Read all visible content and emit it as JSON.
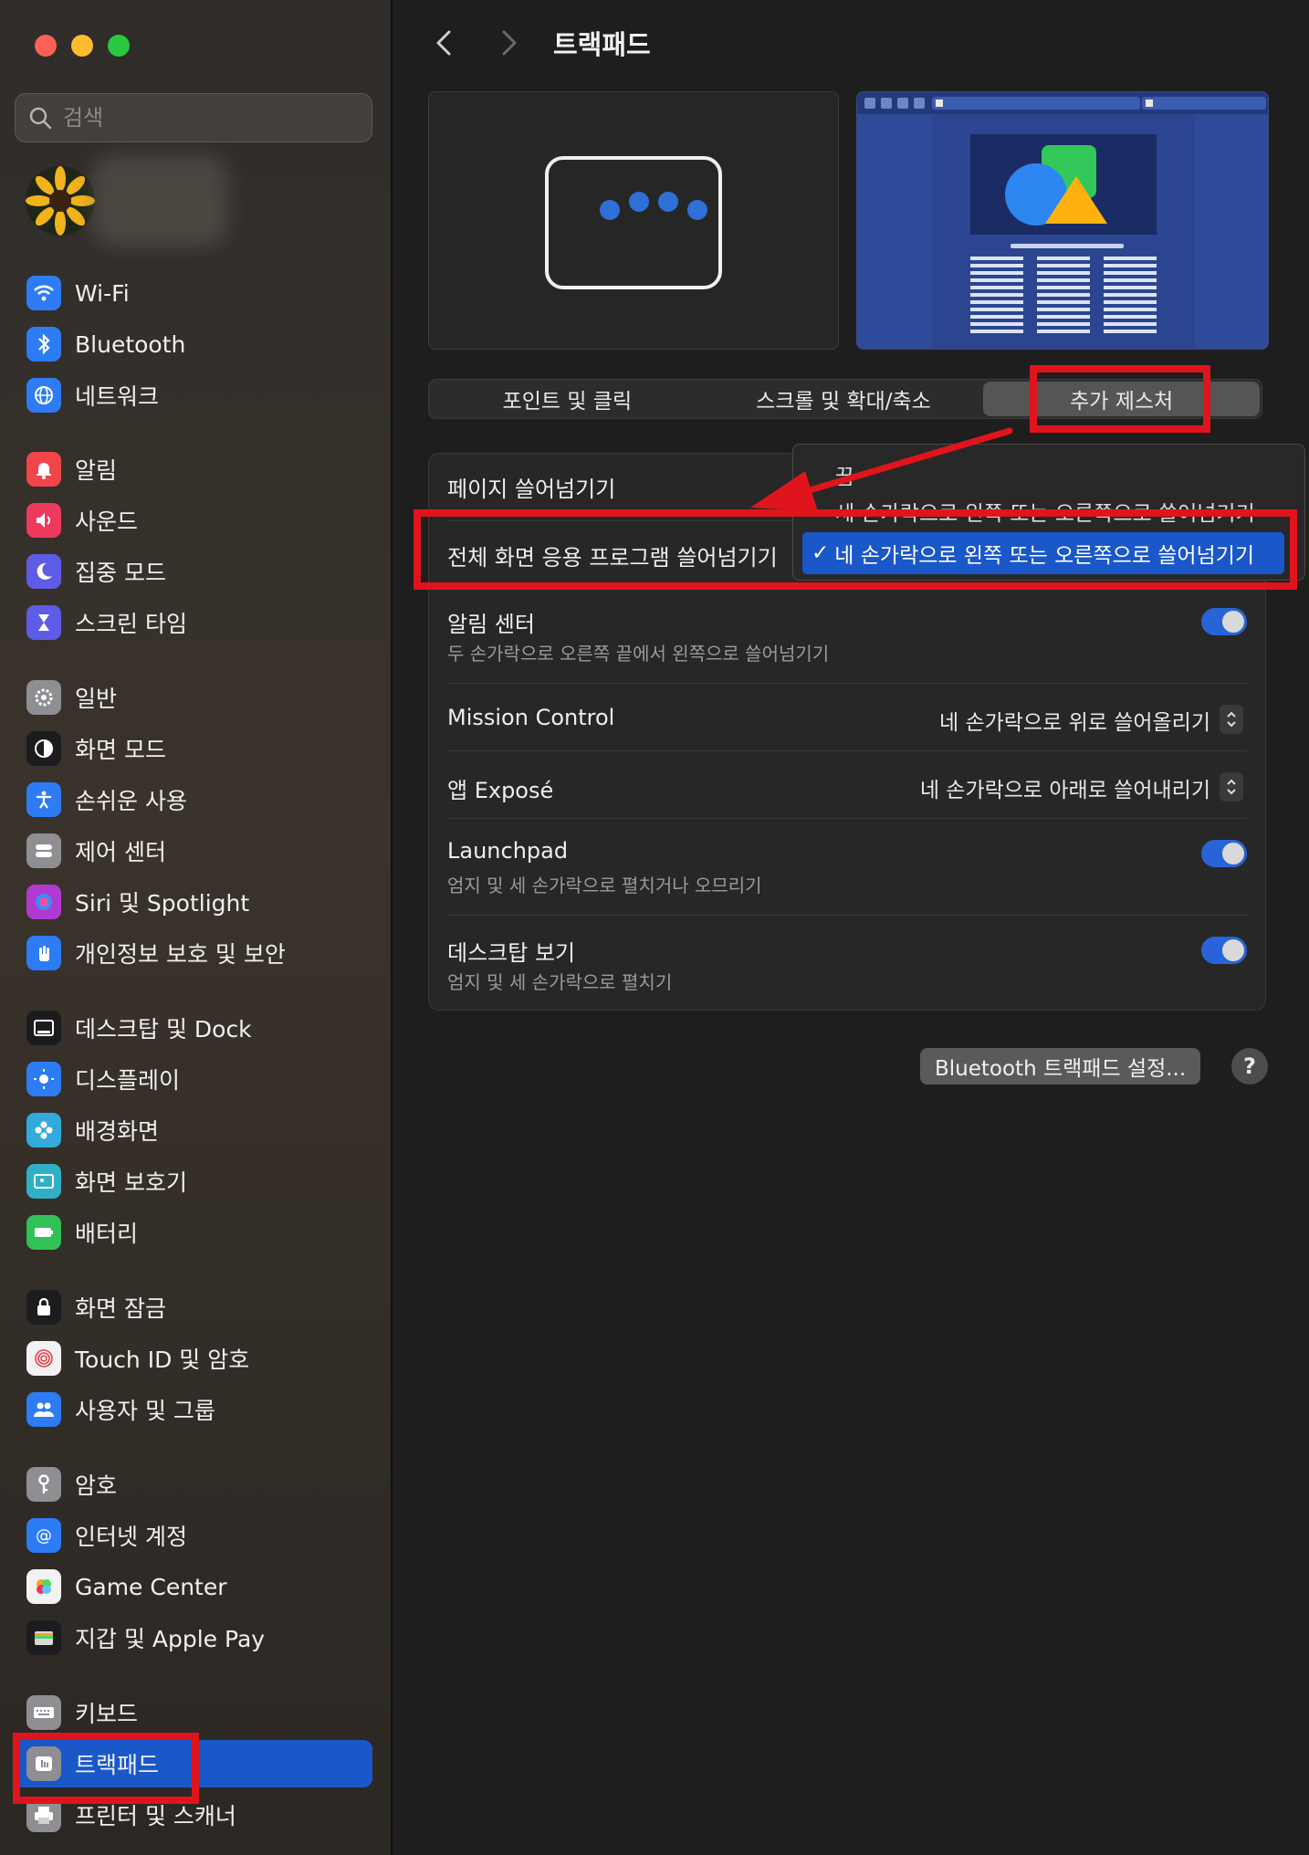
{
  "window": {
    "title": "트랙패드"
  },
  "sidebar": {
    "search_placeholder": "검색",
    "items": [
      {
        "label": "Wi-Fi",
        "icon": "wifi-icon",
        "color": "#2d7cf6"
      },
      {
        "label": "Bluetooth",
        "icon": "bluetooth-icon",
        "color": "#2d7cf6"
      },
      {
        "label": "네트워크",
        "icon": "globe-icon",
        "color": "#2d7cf6"
      },
      {
        "label": "알림",
        "icon": "bell-icon",
        "color": "#f0464a"
      },
      {
        "label": "사운드",
        "icon": "speaker-icon",
        "color": "#ef3a5d"
      },
      {
        "label": "집중 모드",
        "icon": "moon-icon",
        "color": "#5e5ce6"
      },
      {
        "label": "스크린 타임",
        "icon": "hourglass-icon",
        "color": "#5e5ce6"
      },
      {
        "label": "일반",
        "icon": "gear-icon",
        "color": "#8e8e93"
      },
      {
        "label": "화면 모드",
        "icon": "appearance-icon",
        "color": "#1c1c1e"
      },
      {
        "label": "손쉬운 사용",
        "icon": "accessibility-icon",
        "color": "#2d7cf6"
      },
      {
        "label": "제어 센터",
        "icon": "control-center-icon",
        "color": "#8e8e93"
      },
      {
        "label": "Siri 및 Spotlight",
        "icon": "siri-icon",
        "color": "#b03ad0"
      },
      {
        "label": "개인정보 보호 및 보안",
        "icon": "hand-icon",
        "color": "#2d7cf6"
      },
      {
        "label": "데스크탑 및 Dock",
        "icon": "dock-icon",
        "color": "#1c1c1e"
      },
      {
        "label": "디스플레이",
        "icon": "sun-icon",
        "color": "#2d7cf6"
      },
      {
        "label": "배경화면",
        "icon": "flower-icon",
        "color": "#34aadc"
      },
      {
        "label": "화면 보호기",
        "icon": "screensaver-icon",
        "color": "#30b0c7"
      },
      {
        "label": "배터리",
        "icon": "battery-icon",
        "color": "#30c158"
      },
      {
        "label": "화면 잠금",
        "icon": "lock-icon",
        "color": "#1c1c1e"
      },
      {
        "label": "Touch ID 및 암호",
        "icon": "fingerprint-icon",
        "color": "#f2f2f2"
      },
      {
        "label": "사용자 및 그룹",
        "icon": "users-icon",
        "color": "#2d7cf6"
      },
      {
        "label": "암호",
        "icon": "key-icon",
        "color": "#8e8e93"
      },
      {
        "label": "인터넷 계정",
        "icon": "at-icon",
        "color": "#2d7cf6"
      },
      {
        "label": "Game Center",
        "icon": "game-center-icon",
        "color": "#f2f2f2"
      },
      {
        "label": "지갑 및 Apple Pay",
        "icon": "wallet-icon",
        "color": "#1c1c1e"
      },
      {
        "label": "키보드",
        "icon": "keyboard-icon",
        "color": "#8e8e93"
      },
      {
        "label": "트랙패드",
        "icon": "trackpad-icon",
        "color": "#8e8e93",
        "selected": true
      },
      {
        "label": "프린터 및 스캐너",
        "icon": "printer-icon",
        "color": "#8e8e93"
      }
    ]
  },
  "tabs": {
    "point_click": "포인트 및 클릭",
    "scroll_zoom": "스크롤 및 확대/축소",
    "more_gestures": "추가 제스처"
  },
  "settings": {
    "page_swipe": {
      "label": "페이지 쓸어넘기기"
    },
    "fullscreen_swipe": {
      "label": "전체 화면 응용 프로그램 쓸어넘기기"
    },
    "notification_center": {
      "label": "알림 센터",
      "desc": "두 손가락으로 오른쪽 끝에서 왼쪽으로 쓸어넘기기",
      "on": true
    },
    "mission_control": {
      "label": "Mission Control",
      "value": "네 손가락으로 위로 쓸어올리기"
    },
    "app_expose": {
      "label": "앱 Exposé",
      "value": "네 손가락으로 아래로 쓸어내리기"
    },
    "launchpad": {
      "label": "Launchpad",
      "desc": "엄지 및 세 손가락으로 펼치거나 오므리기",
      "on": true
    },
    "show_desktop": {
      "label": "데스크탑 보기",
      "desc": "엄지 및 세 손가락으로 펼치기",
      "on": true
    }
  },
  "dropdown": {
    "item_off": "끔",
    "item_partial": "세 손가락으로 왼쪽 또는 오른쪽으로 쓸어넘기기",
    "selected": "네 손가락으로 왼쪽 또는 오른쪽으로 쓸어넘기기",
    "check": "✓"
  },
  "footer": {
    "bt_button": "Bluetooth 트랙패드 설정...",
    "help": "?"
  },
  "colors": {
    "accent": "#1a57c9",
    "highlight": "#e0141c"
  }
}
